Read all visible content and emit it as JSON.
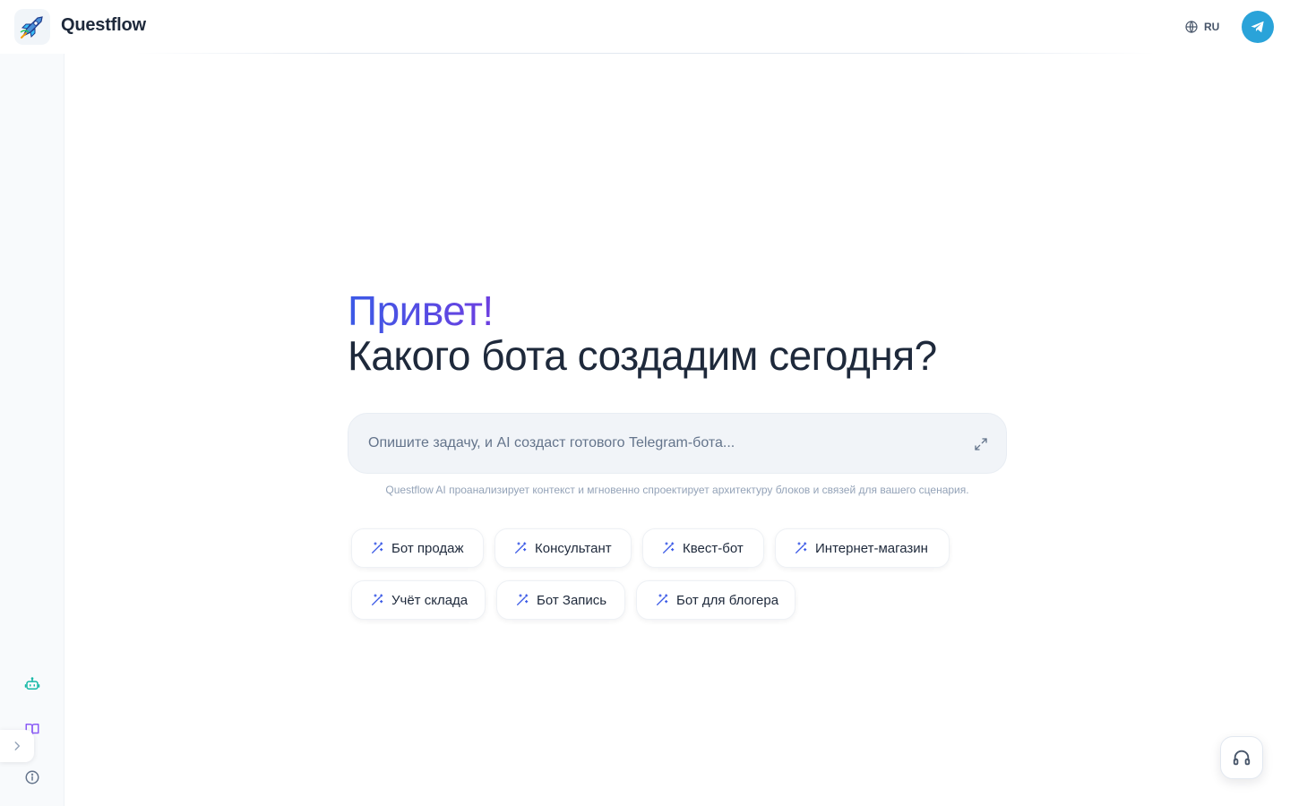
{
  "header": {
    "app_name": "Questflow",
    "language": "RU",
    "logo_icon": "rocket-logo-icon",
    "telegram_icon": "telegram-icon"
  },
  "hero": {
    "greeting": "Привет!",
    "question": "Какого бота создадим сегодня?"
  },
  "prompt": {
    "placeholder": "Опишите задачу, и AI создаст готового Telegram-бота...",
    "value": "",
    "hint": "Questflow AI проанализирует контекст и мгновенно спроектирует архитектуру блоков и связей для вашего сценария."
  },
  "templates": [
    {
      "label": "Бот продаж"
    },
    {
      "label": "Консультант"
    },
    {
      "label": "Квест-бот"
    },
    {
      "label": "Интернет-магазин"
    },
    {
      "label": "Учёт склада"
    },
    {
      "label": "Бот Запись"
    },
    {
      "label": "Бот для блогера"
    }
  ],
  "sidebar": {
    "icons": [
      "bot-icon",
      "book-icon",
      "info-icon"
    ]
  },
  "colors": {
    "accent_start": "#3b5ae6",
    "accent_end": "#6d3fe0",
    "telegram": "#2aa3d9",
    "chip_icon": "#3b5ae6"
  }
}
